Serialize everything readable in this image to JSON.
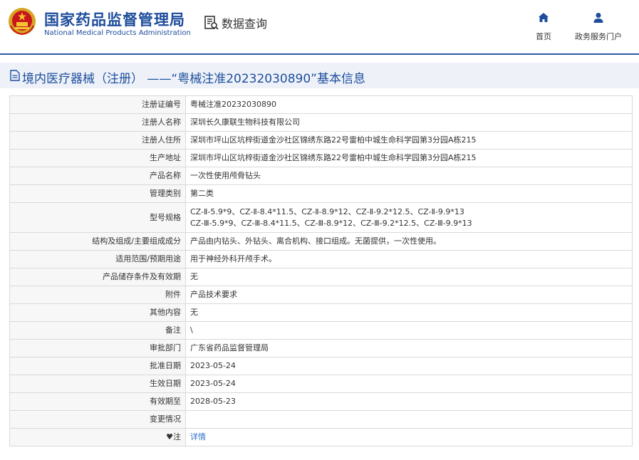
{
  "header": {
    "org_cn": "国家药品监督管理局",
    "org_en": "National Medical Products Administration",
    "query_label": "数据查询",
    "nav": {
      "home_label": "首页",
      "portal_label": "政务服务门户"
    },
    "icons": {
      "emblem": "national-emblem-icon",
      "query": "data-query-icon",
      "home": "home-icon",
      "portal": "user-icon"
    },
    "accent_color": "#1d4d9c"
  },
  "title": "境内医疗器械（注册）  ——“粤械注准20232030890”基本信息",
  "rows": [
    {
      "label": "注册证编号",
      "value": "粤械注准20232030890"
    },
    {
      "label": "注册人名称",
      "value": "深圳长久康联生物科技有限公司"
    },
    {
      "label": "注册人住所",
      "value": "深圳市坪山区坑梓街道金沙社区锦绣东路22号雷柏中城生命科学园第3分园A栋215"
    },
    {
      "label": "生产地址",
      "value": "深圳市坪山区坑梓街道金沙社区锦绣东路22号雷柏中城生命科学园第3分园A栋215"
    },
    {
      "label": "产品名称",
      "value": "一次性使用颅骨钻头"
    },
    {
      "label": "管理类别",
      "value": "第二类"
    },
    {
      "label": "型号规格",
      "value_lines": [
        "CZ-Ⅱ-5.9*9、CZ-Ⅱ-8.4*11.5、CZ-Ⅱ-8.9*12、CZ-Ⅱ-9.2*12.5、CZ-Ⅱ-9.9*13",
        "CZ-Ⅲ-5.9*9、CZ-Ⅲ-8.4*11.5、CZ-Ⅲ-8.9*12、CZ-Ⅲ-9.2*12.5、CZ-Ⅲ-9.9*13"
      ]
    },
    {
      "label": "结构及组成/主要组成成分",
      "value": "产品由内钻头、外钻头、离合机构、接口组成。无菌提供，一次性使用。"
    },
    {
      "label": "适用范围/预期用途",
      "value": "用于神经外科开颅手术。"
    },
    {
      "label": "产品储存条件及有效期",
      "value": "无"
    },
    {
      "label": "附件",
      "value": "产品技术要求"
    },
    {
      "label": "其他内容",
      "value": "无"
    },
    {
      "label": "备注",
      "value": "\\"
    },
    {
      "label": "审批部门",
      "value": "广东省药品监督管理局"
    },
    {
      "label": "批准日期",
      "value": "2023-05-24"
    },
    {
      "label": "生效日期",
      "value": "2023-05-24"
    },
    {
      "label": "有效期至",
      "value": "2028-05-23"
    },
    {
      "label": "变更情况",
      "value": ""
    },
    {
      "label": "♥注",
      "value": "详情"
    }
  ]
}
